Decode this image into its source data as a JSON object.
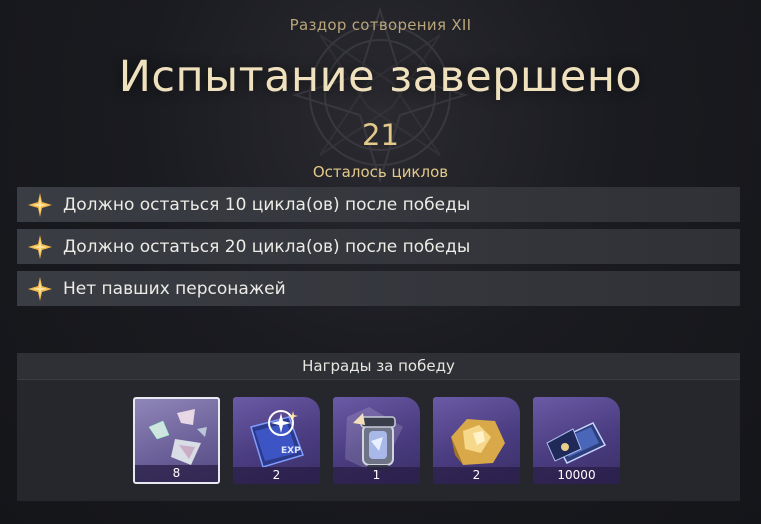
{
  "header": {
    "subtitle": "Раздор сотворения XII",
    "title": "Испытание завершено",
    "cycles_value": "21",
    "cycles_label": "Осталось циклов"
  },
  "conditions": [
    {
      "text": "Должно остаться 10 цикла(ов) после победы",
      "icon": "star-icon"
    },
    {
      "text": "Должно остаться 20 цикла(ов) после победы",
      "icon": "star-icon"
    },
    {
      "text": "Нет павших персонажей",
      "icon": "star-icon"
    }
  ],
  "rewards": {
    "title": "Награды за победу",
    "items": [
      {
        "count": "8",
        "icon": "shards-icon",
        "selected": true
      },
      {
        "count": "2",
        "icon": "book-icon",
        "selected": false
      },
      {
        "count": "1",
        "icon": "lantern-icon",
        "selected": false
      },
      {
        "count": "2",
        "icon": "ore-icon",
        "selected": false
      },
      {
        "count": "10000",
        "icon": "credit-icon",
        "selected": false
      }
    ]
  },
  "colors": {
    "accent_gold": "#e3c98a",
    "title": "#efe1bd",
    "item_purple": "#4a3c80"
  }
}
